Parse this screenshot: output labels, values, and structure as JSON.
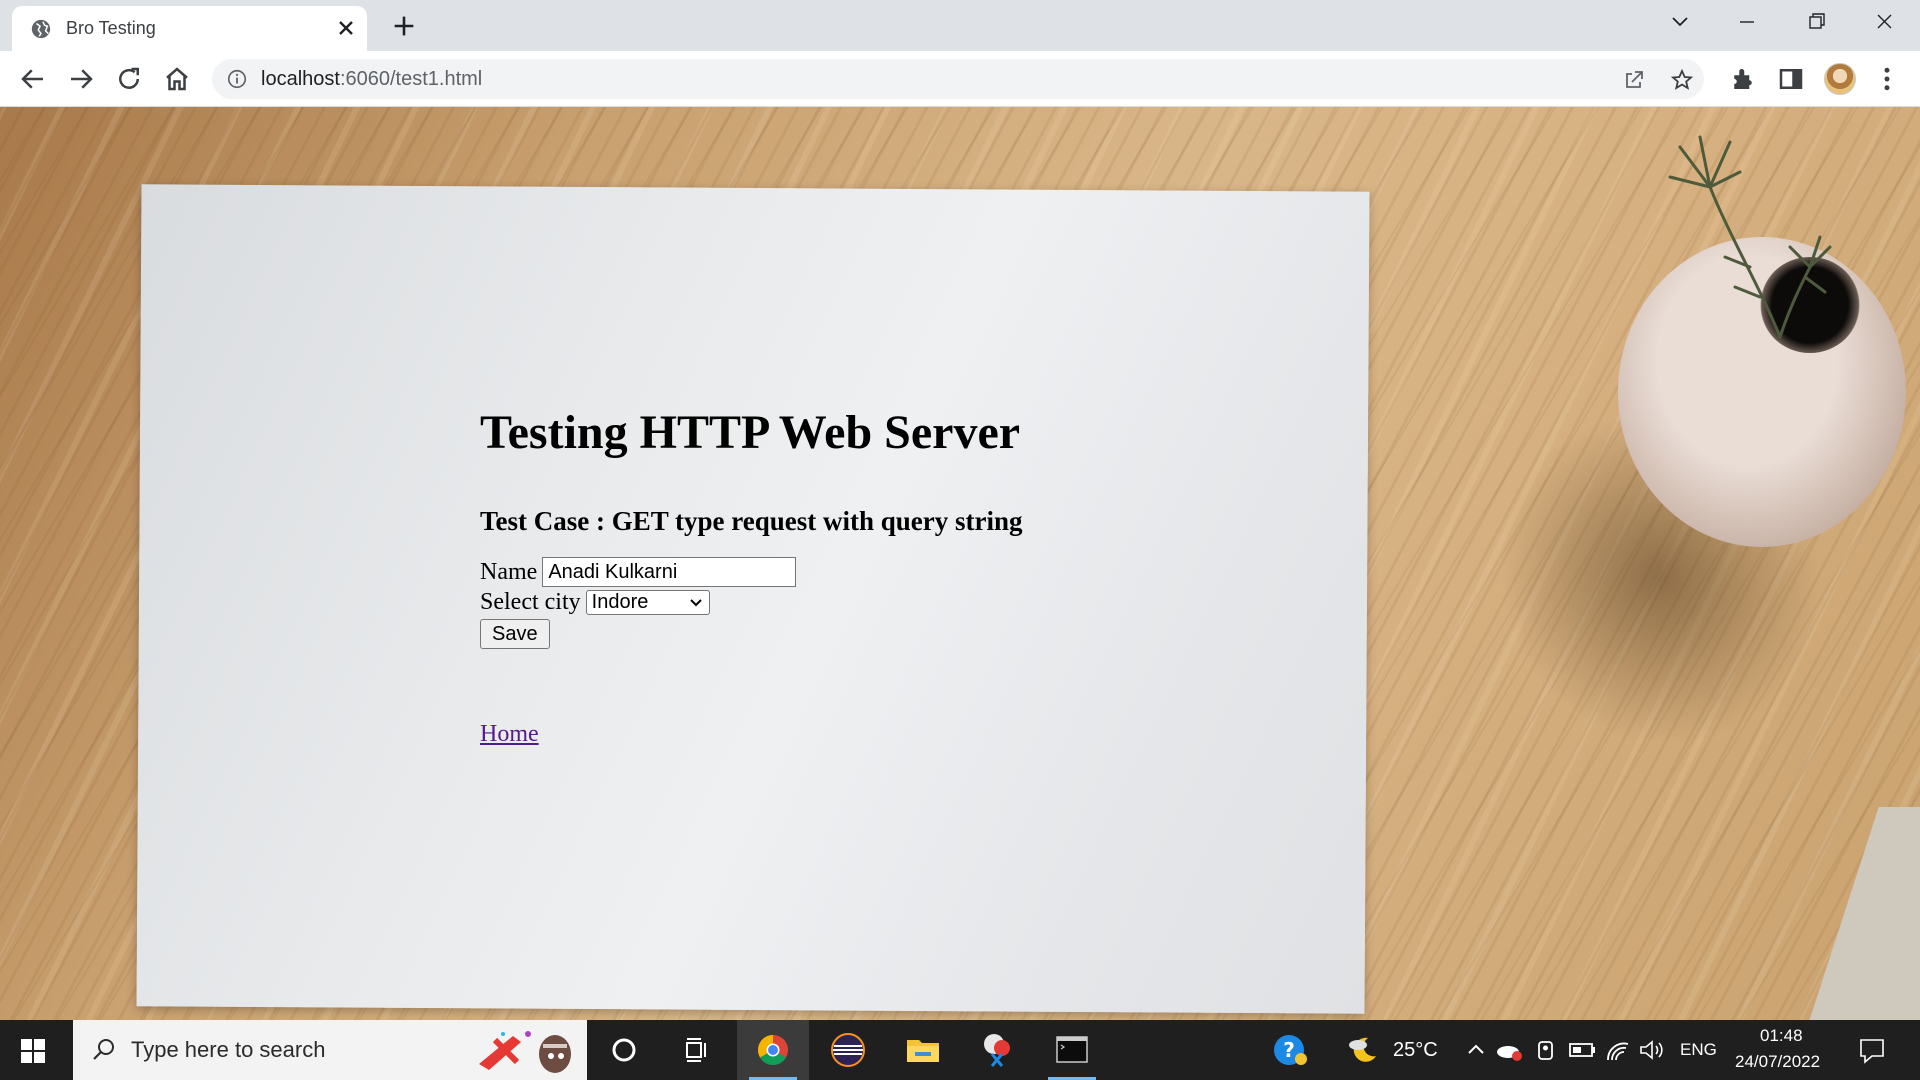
{
  "browser": {
    "tab_title": "Bro Testing",
    "url_host": "localhost",
    "url_path": ":6060/test1.html"
  },
  "page": {
    "heading": "Testing HTTP Web Server",
    "subheading": "Test Case : GET type request with query string",
    "form": {
      "name_label": "Name",
      "name_value": "Anadi Kulkarni",
      "city_label": "Select city",
      "city_selected": "Indore",
      "save_label": "Save"
    },
    "home_link": "Home"
  },
  "taskbar": {
    "search_placeholder": "Type here to search",
    "weather": "25°C",
    "language": "ENG",
    "time": "01:48",
    "date": "24/07/2022"
  },
  "colors": {
    "link_visited": "#551a8b",
    "taskbar_bg": "#1f1f1f",
    "tab_strip_bg": "#dee1e6"
  }
}
